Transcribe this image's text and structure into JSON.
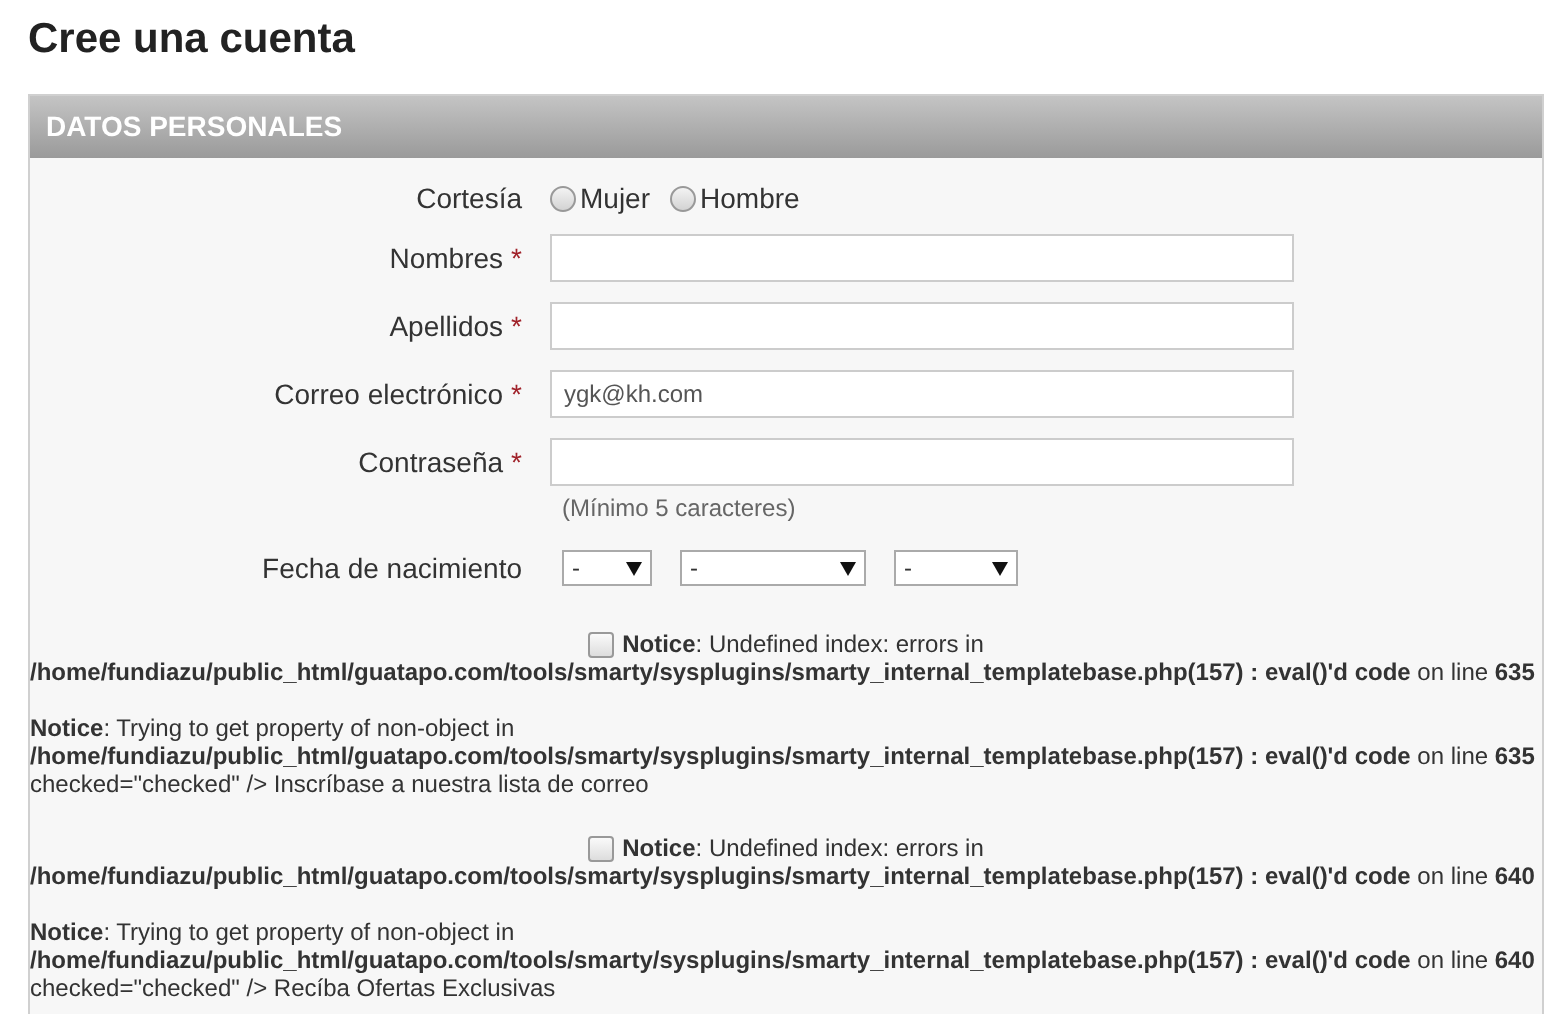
{
  "page_title": "Cree una cuenta",
  "section": {
    "title": "DATOS PERSONALES"
  },
  "courtesy": {
    "label": "Cortesía",
    "options": [
      {
        "label": "Mujer",
        "selected": false
      },
      {
        "label": "Hombre",
        "selected": false
      }
    ]
  },
  "fields": [
    {
      "label": "Nombres",
      "required_mark": "*"
    },
    {
      "label": "Apellidos",
      "required_mark": "*"
    },
    {
      "label": "Correo electrónico",
      "required_mark": "*",
      "value": "ygk@kh.com"
    },
    {
      "label": "Contraseña",
      "required_mark": "*",
      "hint": "(Mínimo 5 caracteres)"
    }
  ],
  "birth_date": {
    "label": "Fecha de nacimiento",
    "selects": [
      {
        "value": "-"
      },
      {
        "value": "-"
      },
      {
        "value": "-"
      }
    ]
  },
  "subscriptions": [
    {
      "checked": false,
      "first_notice": [
        "**Notice**: Undefined index: errors in",
        "**/home/fundiazu/public_html/guatapo.com/tools/smarty/sysplugins/smarty_internal_templatebase.php(157) : eval()'d code** on line **635**"
      ],
      "second_notice": [
        "**Notice**: Trying to get property of non-object in",
        "**/home/fundiazu/public_html/guatapo.com/tools/smarty/sysplugins/smarty_internal_templatebase.php(157) : eval()'d code** on line **635**"
      ],
      "label": "checked=\"checked\" /> Inscríbase a nuestra lista de correo"
    },
    {
      "checked": false,
      "first_notice": [
        "**Notice**: Undefined index: errors in",
        "**/home/fundiazu/public_html/guatapo.com/tools/smarty/sysplugins/smarty_internal_templatebase.php(157) : eval()'d code** on line **640**"
      ],
      "second_notice": [
        "**Notice**: Trying to get property of non-object in",
        "**/home/fundiazu/public_html/guatapo.com/tools/smarty/sysplugins/smarty_internal_templatebase.php(157) : eval()'d code** on line **640**"
      ],
      "label": "checked=\"checked\" /> Recíba Ofertas Exclusivas"
    }
  ]
}
